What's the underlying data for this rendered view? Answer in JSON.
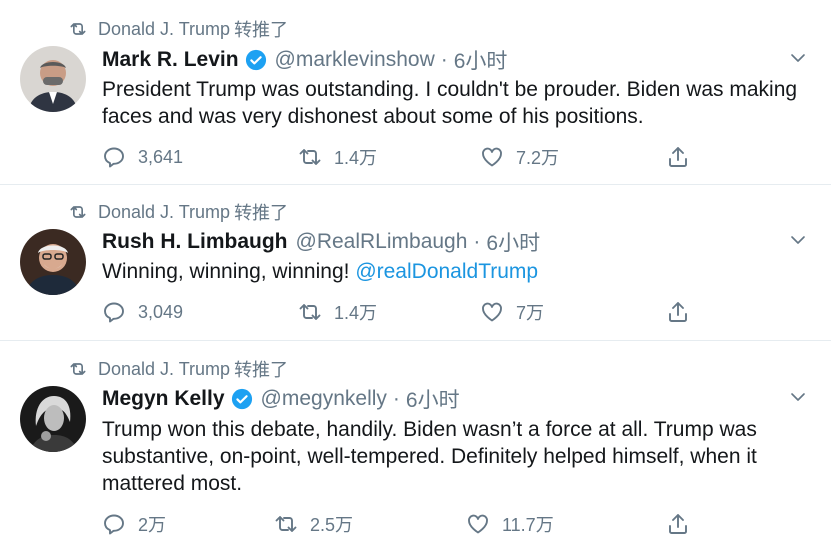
{
  "retweet_label": "转推了",
  "tweets": [
    {
      "retweeter": "Donald J. Trump",
      "name": "Mark R. Levin",
      "verified": true,
      "handle": "@marklevinshow",
      "separator": "·",
      "time": "6小时",
      "text": "President Trump was outstanding.  I couldn't be prouder.  Biden was making faces and was very dishonest about some of his positions.",
      "replies": "3,641",
      "retweets": "1.4万",
      "likes": "7.2万"
    },
    {
      "retweeter": "Donald J. Trump",
      "name": "Rush H. Limbaugh",
      "verified": false,
      "handle": "@RealRLimbaugh",
      "separator": "·",
      "time": "6小时",
      "text": "Winning, winning, winning! ",
      "mention": "@realDonaldTrump",
      "replies": "3,049",
      "retweets": "1.4万",
      "likes": "7万"
    },
    {
      "retweeter": "Donald J. Trump",
      "name": "Megyn Kelly",
      "verified": true,
      "handle": "@megynkelly",
      "separator": "·",
      "time": "6小时",
      "text": "Trump won this debate, handily. Biden wasn’t a force at all. Trump was substantive, on-point, well-tempered. Definitely helped himself, when it mattered most.",
      "replies": "2万",
      "retweets": "2.5万",
      "likes": "11.7万"
    }
  ],
  "colors": {
    "text": "#14171a",
    "secondary": "#657786",
    "link": "#1b95e0",
    "divider": "#e6ecf0"
  }
}
